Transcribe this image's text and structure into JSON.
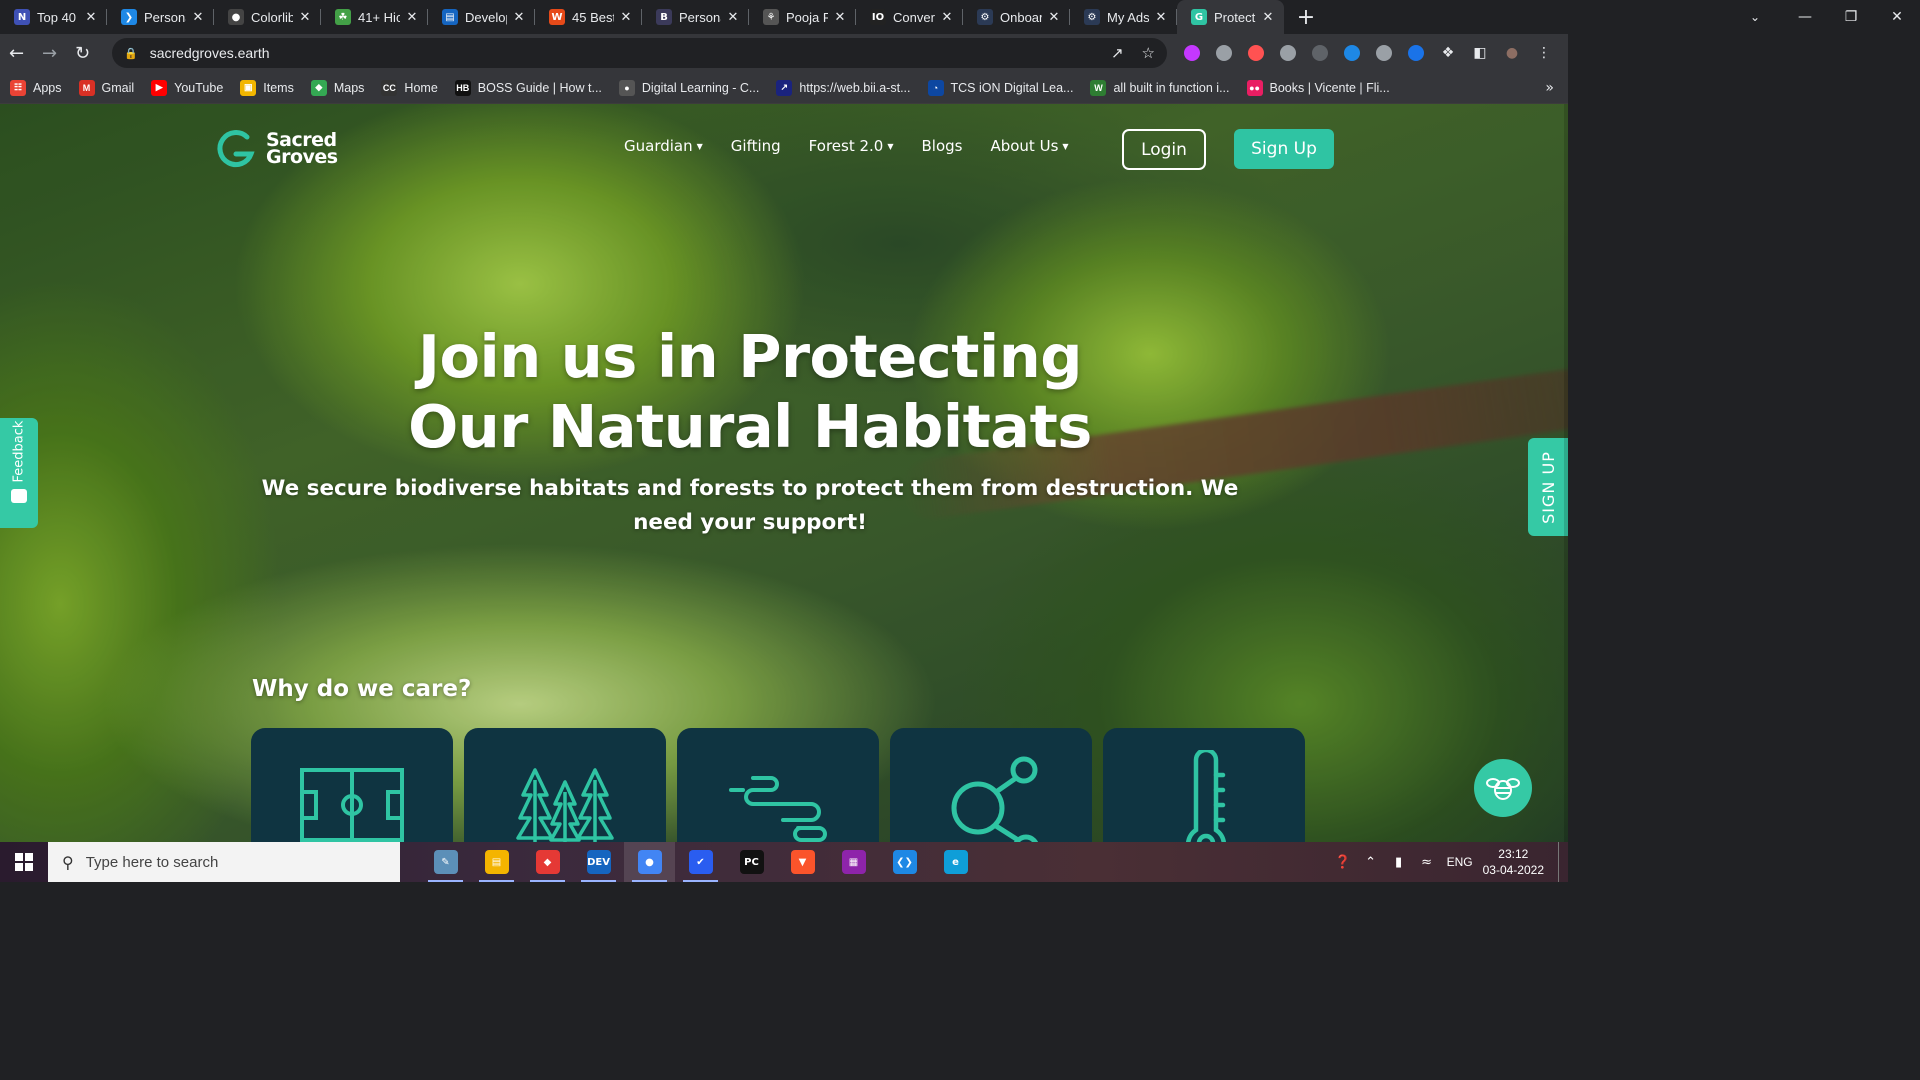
{
  "browser": {
    "tabs": [
      {
        "title": "Top 40",
        "fav_color": "#3f51b5",
        "fav_glyph": "N"
      },
      {
        "title": "Persona",
        "fav_color": "#1e88e5",
        "fav_glyph": "❯"
      },
      {
        "title": "Colorlib",
        "fav_color": "#444444",
        "fav_glyph": "●"
      },
      {
        "title": "41+ Hic",
        "fav_color": "#43a047",
        "fav_glyph": "☘"
      },
      {
        "title": "Develop",
        "fav_color": "#1565c0",
        "fav_glyph": "▤"
      },
      {
        "title": "45 Best",
        "fav_color": "#e64a19",
        "fav_glyph": "W"
      },
      {
        "title": "Persona",
        "fav_color": "#3b3a5a",
        "fav_glyph": "B"
      },
      {
        "title": "Pooja R",
        "fav_color": "#555555",
        "fav_glyph": "⚘"
      },
      {
        "title": "Convert",
        "fav_color": "#222222",
        "fav_glyph": "IO"
      },
      {
        "title": "Onboar",
        "fav_color": "#2b3a55",
        "fav_glyph": "⚙"
      },
      {
        "title": "My Ads",
        "fav_color": "#2b3a55",
        "fav_glyph": "⚙"
      },
      {
        "title": "Protect",
        "fav_color": "#2fc4a3",
        "fav_glyph": "G",
        "active": true
      }
    ],
    "url": "sacredgroves.earth",
    "bookmarks": [
      {
        "label": "Apps",
        "color": "#ea4335",
        "glyph": "☷"
      },
      {
        "label": "Gmail",
        "color": "#d93025",
        "glyph": "M"
      },
      {
        "label": "YouTube",
        "color": "#ff0000",
        "glyph": "▶"
      },
      {
        "label": "Items",
        "color": "#f2b600",
        "glyph": "▣"
      },
      {
        "label": "Maps",
        "color": "#34a853",
        "glyph": "◆"
      },
      {
        "label": "Home",
        "color": "#333333",
        "glyph": "CC"
      },
      {
        "label": "BOSS Guide | How t...",
        "color": "#111111",
        "glyph": "HB"
      },
      {
        "label": "Digital Learning - C...",
        "color": "#555555",
        "glyph": "●"
      },
      {
        "label": "https://web.bii.a-st...",
        "color": "#1a237e",
        "glyph": "↗"
      },
      {
        "label": "TCS iON Digital Lea...",
        "color": "#0d47a1",
        "glyph": "◔"
      },
      {
        "label": "all built in function i...",
        "color": "#2e7d32",
        "glyph": "W"
      },
      {
        "label": "Books | Vicente | Fli...",
        "color": "#e91e63",
        "glyph": "●●"
      }
    ],
    "extension_colors": [
      "#c438ff",
      "#9aa0a6",
      "#ff5252",
      "#9aa0a6",
      "#5f6368",
      "#1e88e5",
      "#9aa0a6",
      "#1a73e8"
    ]
  },
  "site": {
    "logo_line1": "Sacred",
    "logo_line2": "Groves",
    "nav": [
      {
        "label": "Guardian",
        "dropdown": true
      },
      {
        "label": "Gifting",
        "dropdown": false
      },
      {
        "label": "Forest 2.0",
        "dropdown": true
      },
      {
        "label": "Blogs",
        "dropdown": false
      },
      {
        "label": "About Us",
        "dropdown": true
      }
    ],
    "login_label": "Login",
    "signup_label": "Sign Up",
    "hero_line1": "Join us in Protecting",
    "hero_line2": "Our Natural Habitats",
    "hero_sub": "We secure biodiverse habitats and forests to protect them from destruction. We need your support!",
    "why_title": "Why do we care?",
    "cards": [
      {
        "icon": "football-field-icon"
      },
      {
        "icon": "pine-trees-icon"
      },
      {
        "icon": "wind-icon"
      },
      {
        "icon": "molecule-icon"
      },
      {
        "icon": "thermometer-icon"
      }
    ],
    "feedback_label": "Feedback",
    "side_signup_label": "SIGN UP",
    "accent_color": "#2fc4a3",
    "card_color": "#0f3441"
  },
  "taskbar": {
    "search_placeholder": "Type here to search",
    "apps": [
      {
        "name": "notepad",
        "color": "#5c8fb8",
        "glyph": "✎"
      },
      {
        "name": "file-explorer",
        "color": "#f4b400",
        "glyph": "▤"
      },
      {
        "name": "anydesk",
        "color": "#e53935",
        "glyph": "◆"
      },
      {
        "name": "dev",
        "color": "#1565c0",
        "glyph": "DEV"
      },
      {
        "name": "chrome",
        "color": "#4285f4",
        "glyph": "●",
        "active": true
      },
      {
        "name": "todo",
        "color": "#2a5df0",
        "glyph": "✔"
      },
      {
        "name": "pycharm",
        "color": "#111111",
        "glyph": "PC"
      },
      {
        "name": "brave",
        "color": "#fb542b",
        "glyph": "▼"
      },
      {
        "name": "winrar",
        "color": "#8e24aa",
        "glyph": "▦"
      },
      {
        "name": "vscode",
        "color": "#1e88e5",
        "glyph": "❮❯"
      },
      {
        "name": "edge",
        "color": "#0f9ed8",
        "glyph": "e"
      }
    ],
    "language": "ENG",
    "time": "23:12",
    "date": "03-04-2022"
  }
}
